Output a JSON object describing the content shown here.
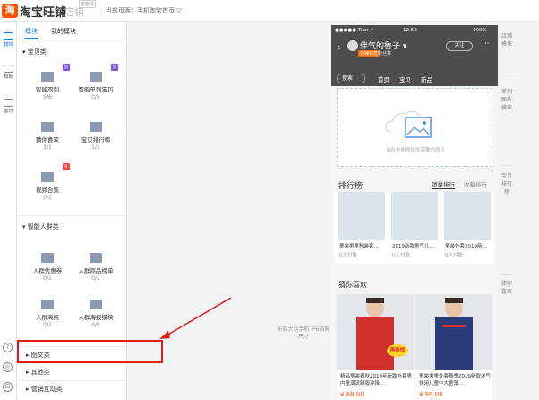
{
  "header": {
    "logo_glyph": "淘",
    "brand": "淘宝旺铺",
    "sub": "店铺",
    "sub_badge": "智能版",
    "current_page": "当前页面：手机淘宝首页 ▽"
  },
  "rail": {
    "items": [
      {
        "label": "模块",
        "icon": "module-icon",
        "active": true
      },
      {
        "label": "模板",
        "icon": "template-icon",
        "active": false
      },
      {
        "label": "备份",
        "icon": "backup-icon",
        "active": false
      }
    ],
    "bottom": [
      "?",
      "◎",
      "⊡"
    ]
  },
  "panel": {
    "tabs": [
      "模块",
      "我的模块"
    ],
    "sections": [
      {
        "title": "▾ 宝贝类",
        "modules": [
          {
            "name": "智能双列",
            "count": "0/6",
            "badge": "智"
          },
          {
            "name": "智能单列宝贝",
            "count": "0/5",
            "badge": "智"
          },
          {
            "name": "猜你喜欢",
            "count": "1/1",
            "badge": ""
          },
          {
            "name": "宝贝排行榜",
            "count": "1/1",
            "badge": ""
          },
          {
            "name": "视频合集",
            "count": "0/1",
            "badge": "R"
          }
        ]
      },
      {
        "title": "▾ 智能人群类",
        "modules": [
          {
            "name": "人群优惠券",
            "count": "0/1",
            "badge": ""
          },
          {
            "name": "人群商品榜单",
            "count": "0/1",
            "badge": ""
          },
          {
            "name": "人群海报",
            "count": "0/1",
            "badge": ""
          },
          {
            "name": "人群海报模块",
            "count": "0/5",
            "badge": ""
          }
        ]
      }
    ],
    "collapsed": [
      "▸ 图文类",
      "▸ 其他类",
      "▸ 营销互动类"
    ]
  },
  "canvas_hint": "布局大众手机 iP6首屏尺寸",
  "phone": {
    "status_left": "●●●●● Tian ✦",
    "status_time": "12:58",
    "status_right": "100%",
    "shop_name": "伴气的魯子 ▾",
    "shop_tag": "店铺标签",
    "shop_level": "粉丝数",
    "follow": "关注",
    "more": "···",
    "search": "搜索",
    "nav": [
      "首页",
      "宝贝",
      "新品"
    ],
    "banner_hint": "请在右侧添加你需要的图片",
    "rank": {
      "title": "排行榜",
      "tabs": [
        "销量排行",
        "收藏排行"
      ],
      "items": [
        {
          "name": "童装男童秋装套…",
          "sales": "0人付款"
        },
        {
          "name": "2019新款男气儿…",
          "sales": "0人付款"
        },
        {
          "name": "童装外套2019新…",
          "sales": "0人付款"
        }
      ]
    },
    "guess": {
      "title": "猜你喜欢",
      "promo": "再查找",
      "items": [
        {
          "name": "精品童装春秋2019年新款外套男内童潮流韩版冲锋…",
          "price": "¥ 88.00"
        },
        {
          "name": "童装男童外套春季2019新款洋气休闲儿童中大童薄…",
          "price": "¥ 99.00"
        }
      ]
    }
  },
  "right_nav": [
    {
      "label": "店铺模块"
    },
    {
      "label": "单列图片模块"
    },
    {
      "label": "宝贝排行榜"
    },
    {
      "label": "猜你喜欢"
    }
  ],
  "colors": {
    "accent": "#1677ff",
    "highlight": "#e31b1b",
    "brand": "#ff5000"
  }
}
